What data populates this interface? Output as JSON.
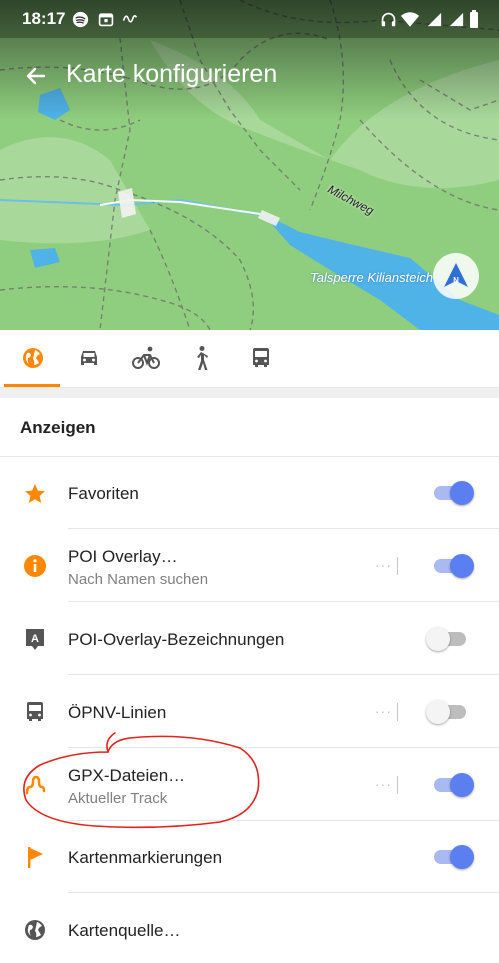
{
  "status_bar": {
    "time": "18:17",
    "icons": [
      "spotify-icon",
      "calendar-icon",
      "signal-wave-icon",
      "headphones-icon",
      "wifi-icon",
      "cell-signal-icon",
      "cell-signal-icon",
      "battery-icon"
    ]
  },
  "header": {
    "title": "Karte konfigurieren",
    "back_icon": "arrow-left-icon"
  },
  "map": {
    "street_label": "Milchweg",
    "water_label": "Talsperre Kiliansteich",
    "compass_letter": "N"
  },
  "tabs": [
    {
      "name": "globe-icon",
      "active": true
    },
    {
      "name": "car-icon",
      "active": false
    },
    {
      "name": "bicycle-icon",
      "active": false
    },
    {
      "name": "pedestrian-icon",
      "active": false
    },
    {
      "name": "bus-icon",
      "active": false
    }
  ],
  "section": {
    "title": "Anzeigen"
  },
  "rows": [
    {
      "label": "Favoriten",
      "sub": "",
      "icon": "star-icon",
      "icon_color": "#ff8800",
      "has_more": false,
      "toggle": "on"
    },
    {
      "label": "POI Overlay…",
      "sub": "Nach Namen suchen",
      "icon": "info-icon",
      "icon_color": "#ff8800",
      "has_more": true,
      "toggle": "on"
    },
    {
      "label": "POI-Overlay-Bezeichnungen",
      "sub": "",
      "icon": "label-a-icon",
      "icon_color": "#555555",
      "has_more": false,
      "toggle": "off"
    },
    {
      "label": "ÖPNV-Linien",
      "sub": "",
      "icon": "bus-icon",
      "icon_color": "#555555",
      "has_more": true,
      "toggle": "off"
    },
    {
      "label": "GPX-Dateien…",
      "sub": "Aktueller Track",
      "icon": "track-icon",
      "icon_color": "#ff8800",
      "has_more": true,
      "toggle": "on"
    },
    {
      "label": "Kartenmarkierungen",
      "sub": "",
      "icon": "flag-icon",
      "icon_color": "#ff8800",
      "has_more": false,
      "toggle": "on"
    },
    {
      "label": "Kartenquelle…",
      "sub": "",
      "icon": "globe-icon",
      "icon_color": "#555555",
      "has_more": false,
      "toggle": "none"
    }
  ],
  "more_glyph": "···",
  "colors": {
    "accent": "#ff8800",
    "switch_on": "#5b7ef1",
    "annotation": "#e2231a"
  }
}
